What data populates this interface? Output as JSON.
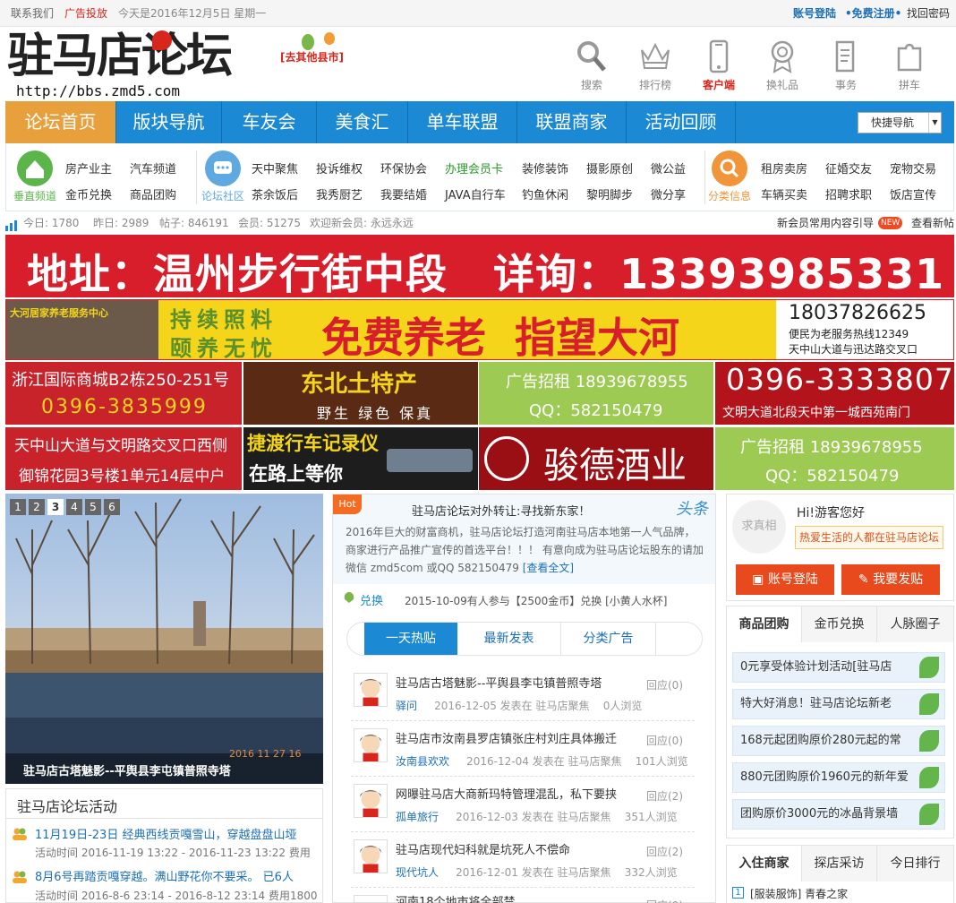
{
  "topbar": {
    "contact": "联系我们",
    "ads": "广告投放",
    "today": "今天是2016年12月5日 星期一",
    "login": "账号登陆",
    "register": "•免费注册•",
    "recover": "找回密码"
  },
  "header": {
    "logo": "驻马店论坛",
    "url": "http://bbs.zmd5.com",
    "county_link": "[去其他县市]",
    "icons": [
      {
        "label": "搜索",
        "icon": "search-icon"
      },
      {
        "label": "排行榜",
        "icon": "crown-icon"
      },
      {
        "label": "客户端",
        "icon": "phone-icon"
      },
      {
        "label": "换礼品",
        "icon": "medal-icon"
      },
      {
        "label": "事务",
        "icon": "document-icon"
      },
      {
        "label": "拼车",
        "icon": "puzzle-icon"
      }
    ]
  },
  "nav": {
    "items": [
      "论坛首页",
      "版块导航",
      "车友会",
      "美食汇",
      "单车联盟",
      "联盟商家",
      "活动回顾"
    ],
    "quick_nav": "快捷导航"
  },
  "categories": {
    "group1_label": "垂直频道",
    "group1_links": [
      "房产业主",
      "汽车频道",
      "金币兑换",
      "商品团购"
    ],
    "group2_label": "论坛社区",
    "group2_links_row1": [
      "天中聚焦",
      "投诉维权",
      "环保协会",
      "办理会员卡",
      "装修装饰",
      "摄影原创",
      "微公益"
    ],
    "group2_links_row2": [
      "茶余饭后",
      "我秀厨艺",
      "我要结婚",
      "JAVA自行车",
      "钓鱼休闲",
      "黎明脚步",
      "微分享"
    ],
    "group3_label": "分类信息",
    "group3_links": [
      "租房卖房",
      "征婚交友",
      "宠物交易",
      "车辆买卖",
      "招聘求职",
      "饭店宣传"
    ]
  },
  "stats": {
    "today": "今日: 1780",
    "yesterday": "昨日: 2989",
    "posts": "帖子: 846191",
    "members": "会员: 51275",
    "welcome": "欢迎新会员: 永远永远",
    "guide": "新会员常用内容引导",
    "new_badge": "NEW",
    "view_new": "查看新帖"
  },
  "banners": {
    "b1": "地址：温州步行街中段   详询：13393985331",
    "b2_left_sign": "大河居家养老服务中心",
    "b2_mid1": "持续照料",
    "b2_mid2": "颐养无忧",
    "b2_main": "免费养老  指望大河",
    "b2_phone": "18037826625",
    "b2_hotline": "便民为老服务热线12349",
    "b2_addr": "天中山大道与迅达路交叉口",
    "b3a_line1": "浙江国际商城B2栋250-251号",
    "b3a_line2": "0396-3835999",
    "b3b_line1": "东北土特产",
    "b3b_line2": "野生 绿色 保真",
    "b3c_line1": "广告招租 18939678955",
    "b3c_line2": "QQ：582150479",
    "b3d_line1": "0396-3333807",
    "b3d_line2": "文明大道北段天中第一城西苑南门",
    "b4a_line1": "天中山大道与文明路交叉口西侧",
    "b4a_line2": "御锦花园3号楼1单元14层中户",
    "b4b_line1": "捷渡行车记录仪",
    "b4b_line2": "在路上等你",
    "b4c": "骏德酒业",
    "b4d_line1": "广告招租 18939678955",
    "b4d_line2": "QQ：582150479"
  },
  "slider": {
    "pages": [
      "1",
      "2",
      "3",
      "4",
      "5",
      "6"
    ],
    "active": "3",
    "caption": "驻马店古塔魅影--平舆县李屯镇普照寺塔",
    "date_stamp": "2016 11 27 16"
  },
  "activity": {
    "title": "驻马店论坛活动",
    "items": [
      {
        "title": "11月19日-23日 经典西线贡嘎雪山，穿越盘盘山垭",
        "meta": "活动时间 2016-11-19 13:22 - 2016-11-23 13:22 费用"
      },
      {
        "title": "8月6号再踏贡嘎穿越。满山野花你不要采。 已6人",
        "meta": "活动时间 2016-8-6 23:14 - 2016-8-12 23:14 费用1800"
      }
    ]
  },
  "headline": {
    "hot_badge": "Hot",
    "title": "驻马店论坛对外转让:寻找新东家！",
    "tag": "头条",
    "body": "2016年巨大的财富商机，驻马店论坛打造河南驻马店本地第一人气品牌，商家进行产品推广宣传的首选平台！！！ 有意向成为驻马店论坛股东的请加微信 zmd5com 或QQ 582150479",
    "read_more": "[查看全文]",
    "exchange_label": "兑换",
    "exchange_text": "2015-10-09有人参与【2500金币】兑换 [小黄人水杯]"
  },
  "post_tabs": [
    "一天热贴",
    "最新发表",
    "分类广告"
  ],
  "posts": [
    {
      "title": "驻马店古塔魅影--平舆县李屯镇普照寺塔",
      "author": "驿问",
      "date": "2016-12-05 发表在 驻马店聚焦",
      "views": "0人浏览",
      "reply": "回应(0)"
    },
    {
      "title": "驻马店市汝南县罗店镇张庄村刘庄具体搬迁",
      "author": "汝南县欢欢",
      "date": "2016-12-04 发表在 驻马店聚焦",
      "views": "101人浏览",
      "reply": "回应(0)"
    },
    {
      "title": "网曝驻马店大商新玛特管理混乱，私下要挟",
      "author": "孤单旅行",
      "date": "2016-12-03 发表在 驻马店聚焦",
      "views": "351人浏览",
      "reply": "回应(2)"
    },
    {
      "title": "驻马店现代妇科就是坑死人不偿命",
      "author": "现代坑人",
      "date": "2016-12-01 发表在 驻马店聚焦",
      "views": "332人浏览",
      "reply": "回应(2)"
    },
    {
      "title": "河南18个地市将全部禁",
      "author": "",
      "date": "",
      "views": "",
      "reply": "回应(0)"
    }
  ],
  "user": {
    "avatar_text": "求真相",
    "greeting": "Hi!游客您好",
    "slogan": "热爱生活的人都在驻马店论坛",
    "login_btn": "账号登陆",
    "post_btn": "我要发贴"
  },
  "right_tabs1": [
    "商品团购",
    "金币兑换",
    "人脉圈子"
  ],
  "group_buy": [
    "0元享受体验计划活动[驻马店",
    "特大好消息！驻马店论坛新老",
    "168元起团购原价280元起的常",
    "880元团购原价1960元的新年爱",
    "团购原价3000元的冰晶背景墙"
  ],
  "right_tabs2": [
    "入住商家",
    "探店采访",
    "今日排行"
  ],
  "merchant": {
    "rank": "1",
    "text": "[服装服饰] 青春之家"
  }
}
